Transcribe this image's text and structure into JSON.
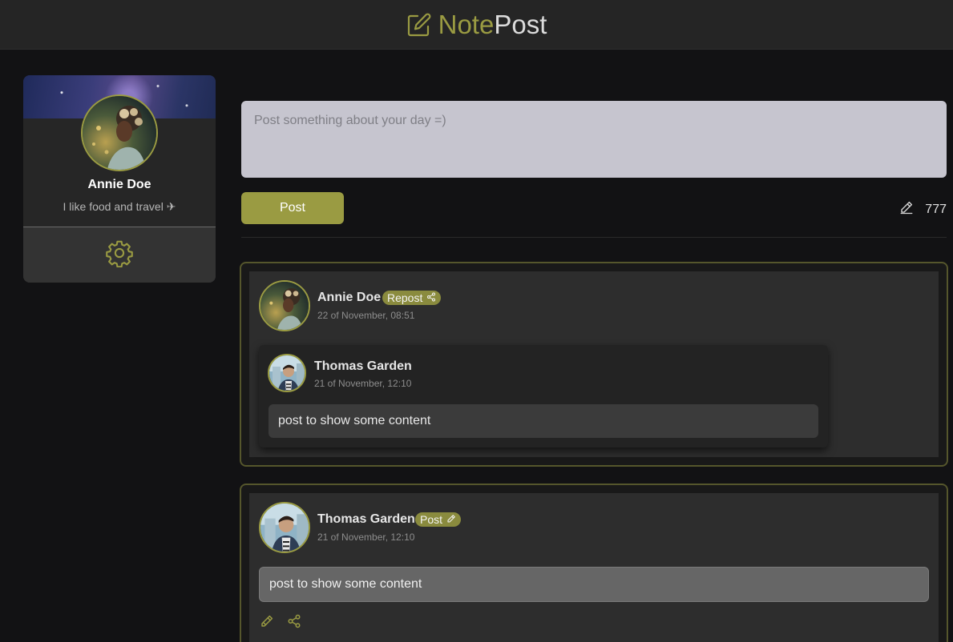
{
  "app": {
    "logo_part1": "Note",
    "logo_part2": "Post"
  },
  "profile": {
    "name": "Annie Doe",
    "bio": "I like food and travel ✈"
  },
  "composer": {
    "placeholder": "Post something about your day =)",
    "post_label": "Post",
    "counter": "777"
  },
  "feed": {
    "repost": {
      "author": "Annie Doe",
      "badge": "Repost",
      "date": "22 of November, 08:51",
      "original": {
        "author": "Thomas Garden",
        "date": "21 of November, 12:10",
        "text": "post to show some content"
      }
    },
    "post": {
      "author": "Thomas Garden",
      "badge": "Post",
      "date": "21 of November, 12:10",
      "text": "post to show some content"
    }
  },
  "colors": {
    "accent": "#9a9b42",
    "background": "#121214",
    "card": "#262626"
  },
  "icons": [
    "edit-square-icon",
    "gear-icon",
    "pencil-icon",
    "share-icon"
  ]
}
